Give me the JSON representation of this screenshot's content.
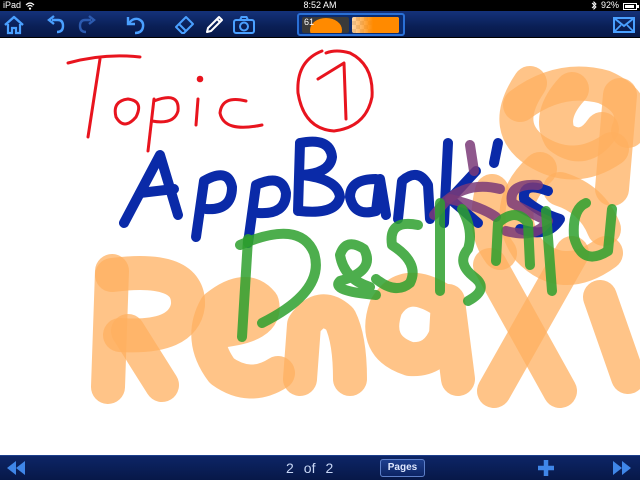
{
  "status_bar": {
    "device": "iPad",
    "time": "8:52 AM",
    "battery_text": "92%",
    "battery_level": 0.92
  },
  "toolbar": {
    "icons": [
      "home-icon",
      "undo-icon",
      "redo-icon",
      "revert-icon",
      "eraser-icon",
      "pen-icon",
      "camera-icon",
      "mail-icon"
    ],
    "pen_size": "61",
    "pen_color": "#ff8a00"
  },
  "canvas": {
    "handwriting": [
      "Topic",
      "1",
      "AppBank's",
      "Design",
      "Renax"
    ],
    "ink_colors": {
      "red": "#e8141e",
      "blue": "#0a2aa8",
      "green": "#2ea02e",
      "purple": "#7a3a78",
      "orange": "#ffb060"
    }
  },
  "bottom_bar": {
    "current_page": "2",
    "of_label": "of",
    "total_pages": "2",
    "pages_button": "Pages",
    "icons": [
      "rewind-icon",
      "add-page-icon",
      "fast-forward-icon"
    ]
  }
}
